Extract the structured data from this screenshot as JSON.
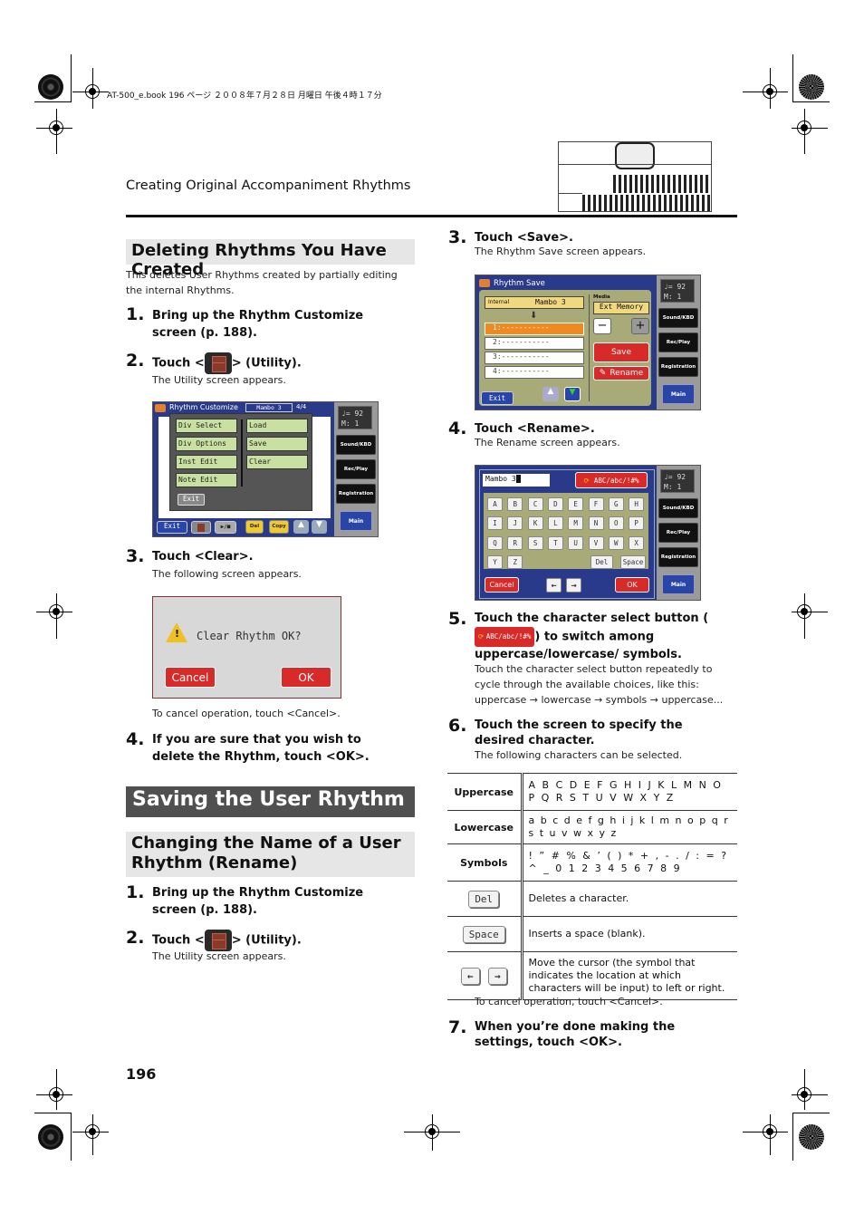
{
  "book_info": "AT-500_e.book  196 ページ  ２００８年７月２８日  月曜日  午後４時１７分",
  "running_head": "Creating Original Accompaniment Rhythms",
  "page_number": "196",
  "left": {
    "section1_title": "Deleting Rhythms You Have Created",
    "section1_intro": "This deletes User Rhythms created by partially editing the internal Rhythms.",
    "steps": [
      {
        "num": "1.",
        "text": "Bring up the Rhythm Customize screen (p. 188)."
      },
      {
        "num": "2.",
        "text_before": "Touch <",
        "text_after": "> (Utility).",
        "sub": "The Utility screen appears."
      },
      {
        "num": "3.",
        "text": "Touch <Clear>.",
        "sub": "The following screen appears."
      },
      {
        "num": "4.",
        "text": "If you are sure that you wish to delete the Rhythm, touch <OK>."
      }
    ],
    "cancel_note": "To cancel operation, touch <Cancel>.",
    "h1_title": "Saving the User Rhythm",
    "section2_title": "Changing the Name of a User Rhythm (Rename)",
    "steps2": [
      {
        "num": "1.",
        "text": "Bring up the Rhythm Customize screen (p. 188)."
      },
      {
        "num": "2.",
        "text_before": "Touch <",
        "text_after": "> (Utility).",
        "sub": "The Utility screen appears."
      }
    ]
  },
  "utility_screen": {
    "title": "Rhythm Customize",
    "rhythm": "Mambo 3",
    "meter": "4/4",
    "left_buttons": [
      "Div Select",
      "Div Options",
      "Inst Edit",
      "Note Edit"
    ],
    "right_buttons": [
      "Load",
      "Save",
      "Clear"
    ],
    "exit": "Exit",
    "bottom": {
      "exit": "Exit",
      "play": "▶/■",
      "del": "Del",
      "copy": "Copy"
    }
  },
  "side_panel": {
    "tempo": "♩= 92",
    "measure": "M:   1",
    "buttons": [
      "Sound/KBD",
      "Rec/Play",
      "Registration"
    ],
    "main": "Main"
  },
  "clear_dialog": {
    "message": "Clear Rhythm OK?",
    "cancel": "Cancel",
    "ok": "OK"
  },
  "right": {
    "steps": [
      {
        "num": "3.",
        "text": "Touch <Save>.",
        "sub": "The Rhythm Save screen appears."
      },
      {
        "num": "4.",
        "text": "Touch <Rename>.",
        "sub": "The Rename screen appears."
      },
      {
        "num": "5.",
        "text_before": "Touch the character select button (",
        "text_after": ") to switch among uppercase/lowercase/ symbols.",
        "sub": "Touch the character select button repeatedly to cycle through the available choices, like this: uppercase → lowercase → symbols → uppercase..."
      },
      {
        "num": "6.",
        "text": "Touch the screen to specify the desired character.",
        "sub": "The following characters can be selected."
      },
      {
        "num": "7.",
        "text": "When you’re done making the settings, touch <OK>."
      }
    ],
    "cancel_note": "To cancel operation, touch <Cancel>."
  },
  "save_screen": {
    "title": "Rhythm Save",
    "source_label": "Internal",
    "source_name": "Mambo 3",
    "media_label": "Media",
    "media_value": "Ext Memory",
    "slots": [
      "1:-----------",
      "2:-----------",
      "3:-----------",
      "4:-----------"
    ],
    "minus": "−",
    "plus": "+",
    "save": "Save",
    "rename": "Rename",
    "exit": "Exit"
  },
  "rename_screen": {
    "name_value": "Mambo 3",
    "char_select": "ABC/abc/!#%",
    "keys": [
      "A",
      "B",
      "C",
      "D",
      "E",
      "F",
      "G",
      "H",
      "I",
      "J",
      "K",
      "L",
      "M",
      "N",
      "O",
      "P",
      "Q",
      "R",
      "S",
      "T",
      "U",
      "V",
      "W",
      "X",
      "Y",
      "Z"
    ],
    "del": "Del",
    "space": "Space",
    "cancel": "Cancel",
    "ok": "OK",
    "left_arrow": "←",
    "right_arrow": "→"
  },
  "char_select_inline": "ABC/abc/!#%",
  "char_table": {
    "rows": [
      {
        "label": "Uppercase",
        "value": "A B C D E F G H I J K L M N O P Q R S T U V W X Y Z"
      },
      {
        "label": "Lowercase",
        "value": "a b c d e f g h i j k l m n o p q r s t u v w x y z"
      },
      {
        "label": "Symbols",
        "value": "! ” # % & ’ ( ) * + , - . / : = ? ^ _ 0 1 2 3 4 5 6 7 8 9"
      }
    ],
    "button_rows": [
      {
        "button": "Del",
        "desc": "Deletes a character."
      },
      {
        "button": "Space",
        "desc": "Inserts a space (blank)."
      },
      {
        "buttons": [
          "←",
          "→"
        ],
        "desc": "Move the cursor (the symbol that indicates the location at which characters will be input) to left or right."
      }
    ]
  }
}
